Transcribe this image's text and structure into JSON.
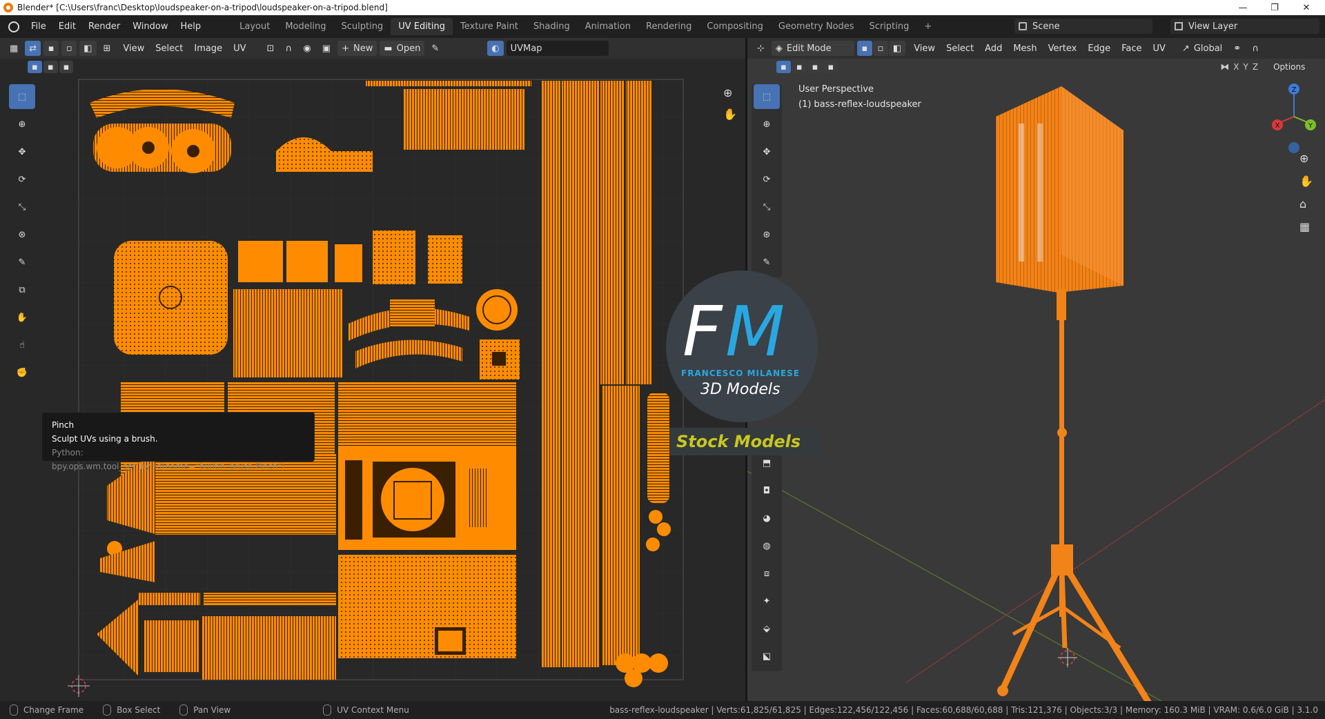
{
  "window": {
    "title": "Blender* [C:\\Users\\franc\\Desktop\\loudspeaker-on-a-tripod\\loudspeaker-on-a-tripod.blend]",
    "minimize": "—",
    "maximize": "❐",
    "close": "✕"
  },
  "menu": {
    "items": [
      "File",
      "Edit",
      "Render",
      "Window",
      "Help"
    ]
  },
  "workspaces": {
    "tabs": [
      "Layout",
      "Modeling",
      "Sculpting",
      "UV Editing",
      "Texture Paint",
      "Shading",
      "Animation",
      "Rendering",
      "Compositing",
      "Geometry Nodes",
      "Scripting"
    ],
    "active": "UV Editing",
    "add": "+"
  },
  "scene": {
    "name": "Scene",
    "view_layer": "View Layer"
  },
  "uv_editor": {
    "menus": [
      "View",
      "Select",
      "Image",
      "UV"
    ],
    "new_label": "New",
    "open_label": "Open",
    "uvmap": "UVMap",
    "tooltip": {
      "title": "Pinch",
      "description": "Sculpt UVs using a brush.",
      "python": "Python: bpy.ops.wm.tool_set_by_id(name=\"builtin_brush.Pinch\")"
    }
  },
  "viewport": {
    "mode": "Edit Mode",
    "menus": [
      "View",
      "Select",
      "Add",
      "Mesh",
      "Vertex",
      "Edge",
      "Face",
      "UV"
    ],
    "orientation": "Global",
    "axes_labels": [
      "X",
      "Y",
      "Z"
    ],
    "options_label": "Options",
    "perspective": "User Perspective",
    "object_label": "(1) bass-reflex-loudspeaker",
    "gizmo": {
      "x": "X",
      "y": "Y",
      "z": "Z"
    }
  },
  "watermark": {
    "letters_f": "F",
    "letters_m": "M",
    "name": "FRANCESCO MILANESE",
    "sub": "3D Models",
    "banner": "Stock Models"
  },
  "status": {
    "items": [
      "Change Frame",
      "Box Select",
      "Pan View",
      "UV Context Menu"
    ],
    "stats": "bass-reflex-loudspeaker | Verts:61,825/61,825 | Edges:122,456/122,456 | Faces:60,688/60,688 | Tris:121,376 | Objects:3/3 | Memory: 160.3 MiB | VRAM: 0.6/6.0 GiB | 3.1.0"
  },
  "colors": {
    "uv_orange": "#ff8c00",
    "mesh_orange": "#f28318",
    "active_blue": "#4772b3",
    "fm_blue": "#2aa7e0",
    "banner_yellow": "#c8c81e"
  }
}
